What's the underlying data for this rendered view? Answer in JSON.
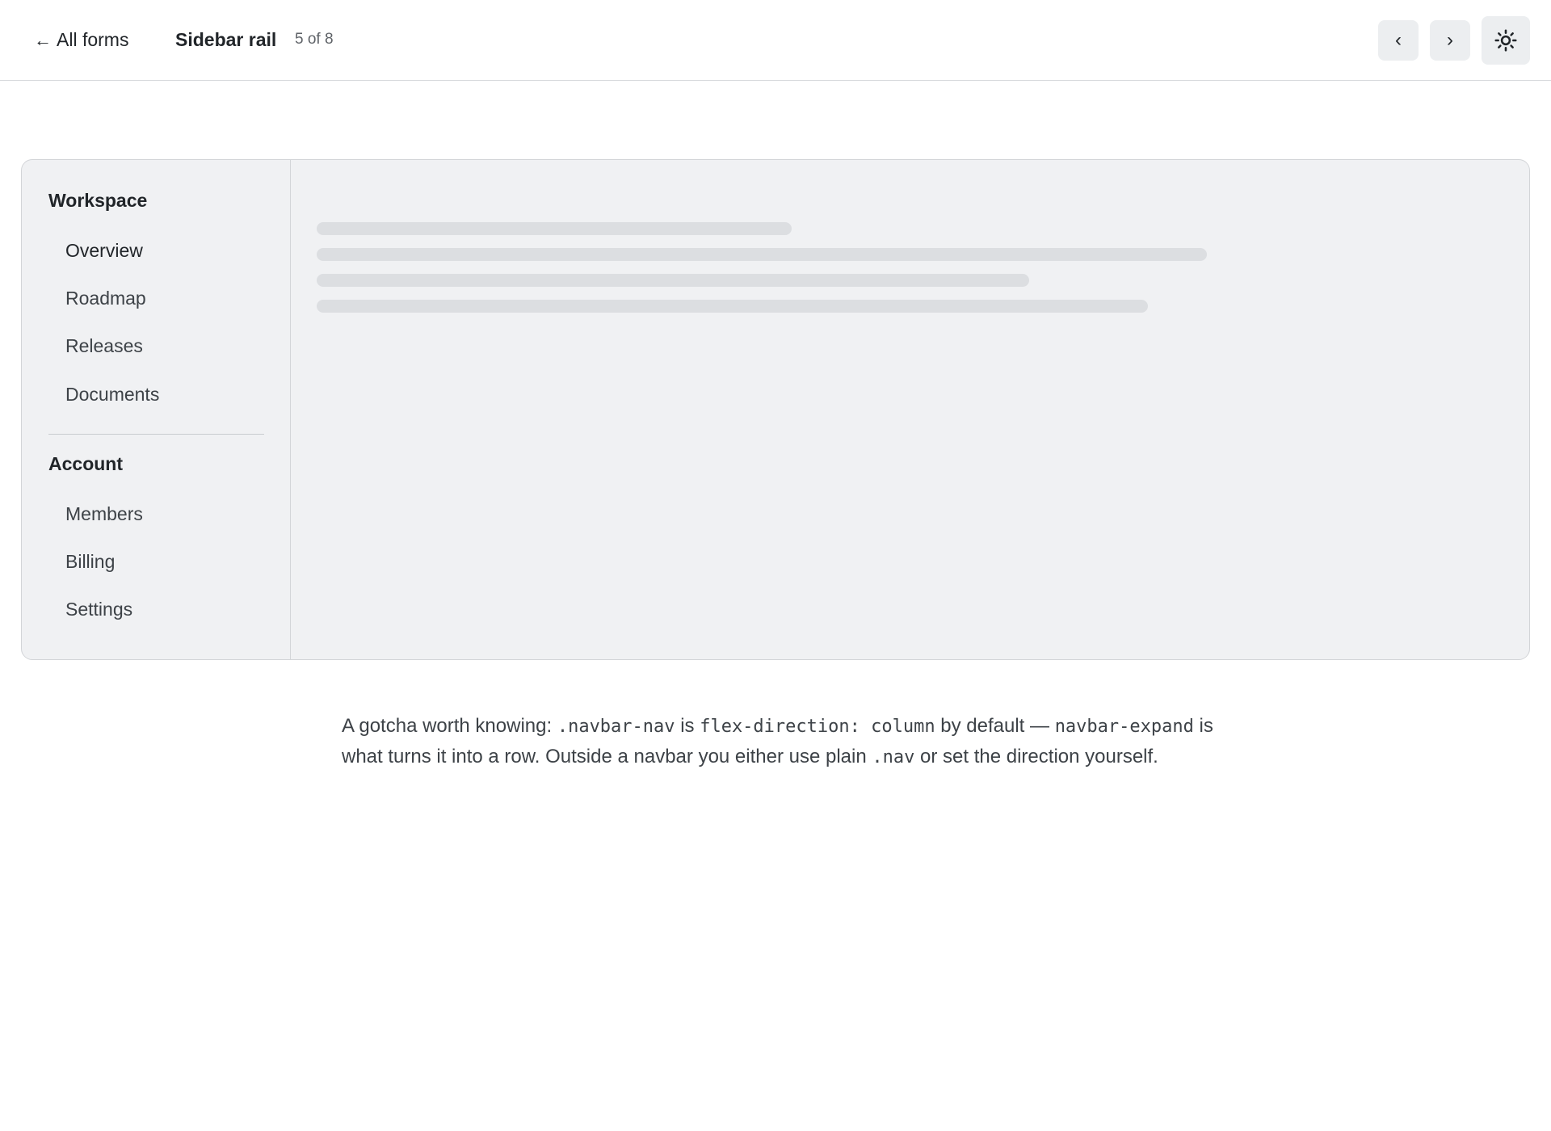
{
  "header": {
    "back_arrow": "←",
    "back_label": "All forms",
    "title": "Sidebar rail",
    "count": "5 of 8",
    "prev_label": "‹",
    "next_label": "›",
    "theme_icon": "sun-icon"
  },
  "sidebar": {
    "workspace_heading": "Workspace",
    "workspace_items": [
      "Overview",
      "Roadmap",
      "Releases",
      "Documents"
    ],
    "account_heading": "Account",
    "account_items": [
      "Members",
      "Billing",
      "Settings"
    ]
  },
  "note": {
    "p1": "A gotcha worth knowing: ",
    "c1": ".navbar-nav",
    "p2": " is ",
    "c2": "flex-direction: column",
    "p3": " by default — ",
    "c3": "navbar-expand",
    "p4": " is what turns it into a row. Outside a navbar you either use plain ",
    "c4": ".nav",
    "p5": " or set the direction yourself."
  },
  "colors": {
    "card_bg": "#f0f1f3",
    "skeleton": "#dcdee1",
    "button_bg": "#eceef0"
  }
}
